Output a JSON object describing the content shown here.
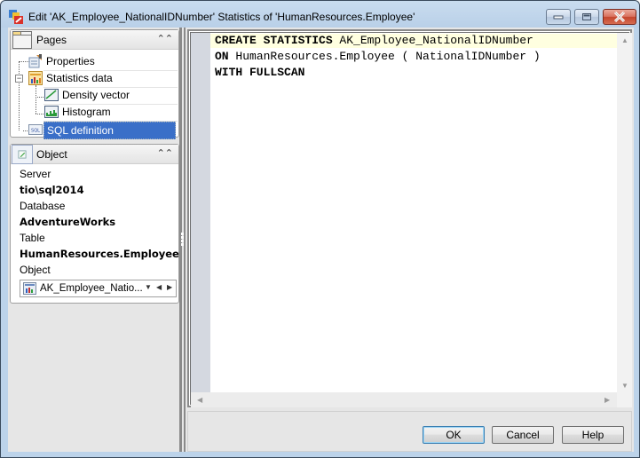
{
  "window": {
    "title": "Edit 'AK_Employee_NationalIDNumber' Statistics of 'HumanResources.Employee'",
    "controls": [
      "minimize",
      "maximize",
      "close"
    ]
  },
  "pages_panel": {
    "header": "Pages",
    "items": [
      {
        "label": "Properties",
        "icon": "properties-icon",
        "level": 0
      },
      {
        "label": "Statistics data",
        "icon": "statistics-icon",
        "level": 0,
        "expanded": true
      },
      {
        "label": "Density vector",
        "icon": "density-vector-icon",
        "level": 1
      },
      {
        "label": "Histogram",
        "icon": "histogram-icon",
        "level": 1
      },
      {
        "label": "SQL definition",
        "icon": "sql-icon",
        "level": 0,
        "selected": true
      }
    ]
  },
  "object_panel": {
    "header": "Object",
    "server_label": "Server",
    "server_value": "tio\\sql2014",
    "database_label": "Database",
    "database_value": "AdventureWorks",
    "table_label": "Table",
    "table_value": "HumanResources.Employee",
    "object_label": "Object",
    "object_value": "AK_Employee_Natio..."
  },
  "editor": {
    "lines": [
      {
        "keyword": "CREATE STATISTICS",
        "rest": " AK_Employee_NationalIDNumber"
      },
      {
        "keyword": "ON",
        "rest": " HumanResources.Employee ( NationalIDNumber )"
      },
      {
        "keyword": "WITH FULLSCAN",
        "rest": ""
      }
    ]
  },
  "buttons": {
    "ok": "OK",
    "cancel": "Cancel",
    "help": "Help"
  },
  "colors": {
    "selection": "#3a6fc8",
    "current_line": "#ffffe0",
    "gutter": "#d4d8e0",
    "window_frame": "#bcd3ea",
    "close_button": "#c4452d"
  }
}
